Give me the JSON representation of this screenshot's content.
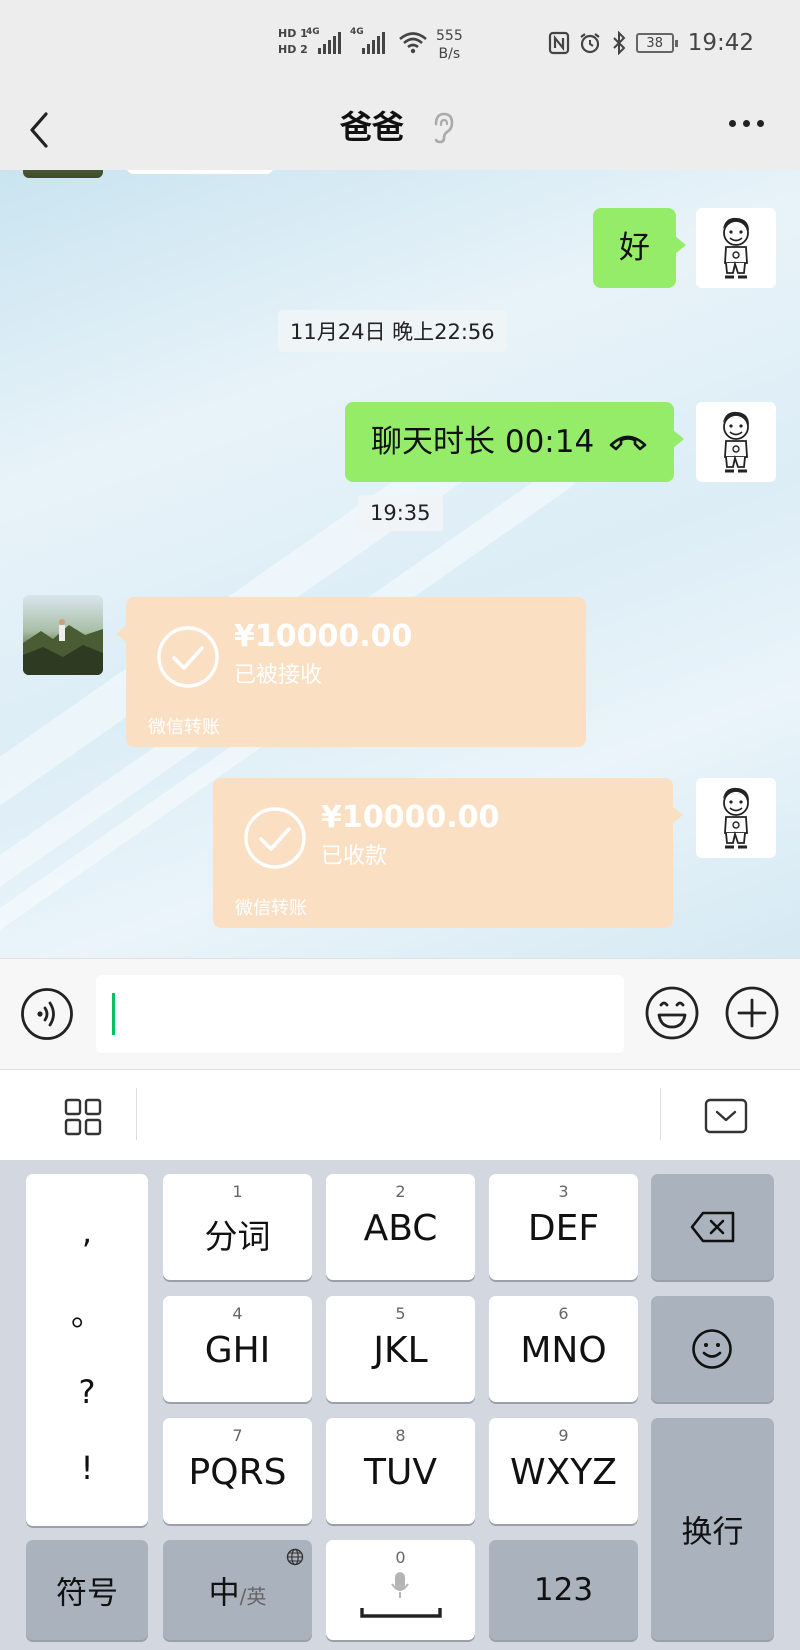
{
  "status_bar": {
    "hd1": "HD 1",
    "hd2": "HD 2",
    "net1": "4G",
    "net2": "4G",
    "speed_value": "555",
    "speed_unit": "B/s",
    "battery": "38",
    "time": "19:42"
  },
  "nav": {
    "title": "爸爸"
  },
  "messages": {
    "msg1_text": "好",
    "timestamp1": "11月24日 晚上22:56",
    "call_text": "聊天时长 00:14",
    "timestamp2": "19:35",
    "transfer1": {
      "amount": "¥10000.00",
      "status": "已被接收",
      "label": "微信转账"
    },
    "transfer2": {
      "amount": "¥10000.00",
      "status": "已收款",
      "label": "微信转账"
    }
  },
  "keyboard": {
    "punct": [
      ",",
      "。",
      "?",
      "!"
    ],
    "keys": [
      {
        "num": "1",
        "label": "分词"
      },
      {
        "num": "2",
        "label": "ABC"
      },
      {
        "num": "3",
        "label": "DEF"
      },
      {
        "num": "4",
        "label": "GHI"
      },
      {
        "num": "5",
        "label": "JKL"
      },
      {
        "num": "6",
        "label": "MNO"
      },
      {
        "num": "7",
        "label": "PQRS"
      },
      {
        "num": "8",
        "label": "TUV"
      },
      {
        "num": "9",
        "label": "WXYZ"
      }
    ],
    "symbols": "符号",
    "lang_main": "中",
    "lang_sub": "/英",
    "space_num": "0",
    "num_key": "123",
    "enter": "换行"
  },
  "colors": {
    "bubble_green": "#95ec69",
    "transfer_bg": "#fbdfc3",
    "cursor": "#07c160"
  }
}
